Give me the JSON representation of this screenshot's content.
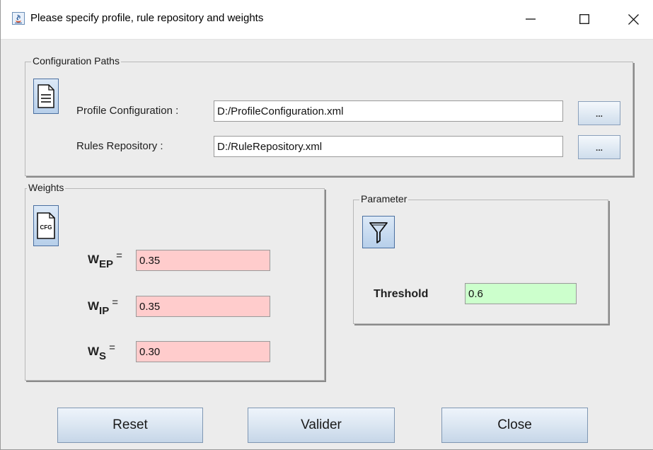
{
  "window": {
    "title": "Please specify profile, rule repository and weights",
    "icons": {
      "app": "java-app-icon",
      "minimize": "minimize-icon",
      "maximize": "maximize-icon",
      "close": "close-icon"
    }
  },
  "config_paths": {
    "title": "Configuration Paths",
    "icon": "document-icon",
    "profile_label": "Profile Configuration :",
    "profile_value": "D:/ProfileConfiguration.xml",
    "profile_browse": "...",
    "rules_label": "Rules Repository  :",
    "rules_value": "D:/RuleRepository.xml",
    "rules_browse": "..."
  },
  "weights": {
    "title": "Weights",
    "icon": "cfg-file-icon",
    "icon_text": "CFG",
    "eq_sign": "=",
    "items": [
      {
        "symbol": "W",
        "sub": "EP",
        "value": "0.35",
        "color": "#ffcccc"
      },
      {
        "symbol": "W",
        "sub": "IP",
        "value": "0.35",
        "color": "#ffcccc"
      },
      {
        "symbol": "W",
        "sub": "S",
        "value": "0.30",
        "color": "#ffcccc"
      }
    ]
  },
  "parameter": {
    "title": "Parameter",
    "icon": "filter-icon",
    "threshold_label": "Threshold",
    "threshold_value": "0.6",
    "threshold_color": "#ccffcc"
  },
  "buttons": {
    "reset": "Reset",
    "validate": "Valider",
    "close": "Close"
  }
}
